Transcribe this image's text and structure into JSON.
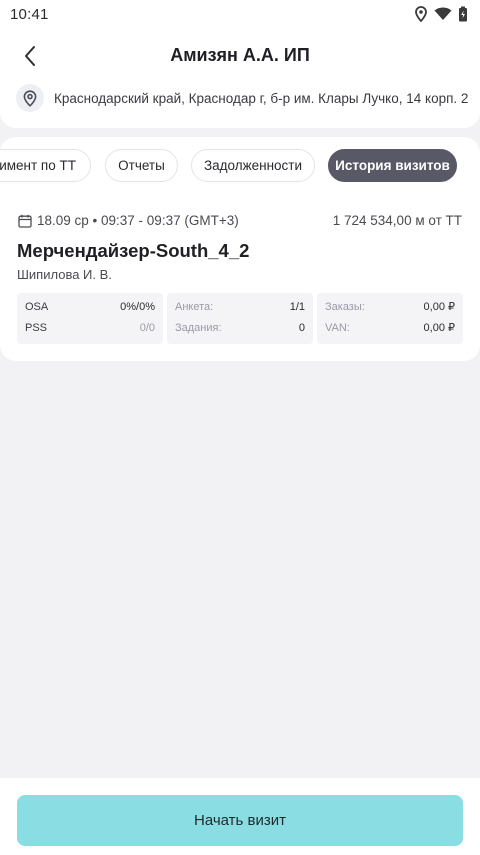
{
  "status_bar": {
    "time": "10:41",
    "icons": [
      "location-icon",
      "wifi-icon",
      "battery-icon"
    ]
  },
  "header": {
    "title": "Амизян А.А. ИП",
    "address": "Краснодарский край, Краснодар г, б-р им. Клары Лучко, 14 корп. 2"
  },
  "tabs": [
    {
      "label": "Ассортимент по ТТ",
      "active": false
    },
    {
      "label": "Отчеты",
      "active": false
    },
    {
      "label": "Задолженности",
      "active": false
    },
    {
      "label": "История визитов",
      "active": true
    }
  ],
  "visit": {
    "date": "18.09 ср • 09:37 - 09:37 (GMT+3)",
    "distance": "1 724 534,00 м от ТТ",
    "title": "Мерчендайзер-South_4_2",
    "user": "Шипилова И. В.",
    "stats": [
      {
        "rows": [
          {
            "label": "OSA",
            "value": "0%/0%"
          },
          {
            "label": "PSS",
            "value": "0/0"
          }
        ]
      },
      {
        "rows": [
          {
            "label": "Анкета:",
            "value": "1/1"
          },
          {
            "label": "Задания:",
            "value": "0"
          }
        ]
      },
      {
        "rows": [
          {
            "label": "Заказы:",
            "value": "0,00 ₽"
          },
          {
            "label": "VAN:",
            "value": "0,00 ₽"
          }
        ]
      }
    ]
  },
  "actions": {
    "start_visit": "Начать визит"
  },
  "colors": {
    "accent_button": "#8adde3",
    "active_tab": "#585866",
    "background": "#f2f2f5"
  }
}
